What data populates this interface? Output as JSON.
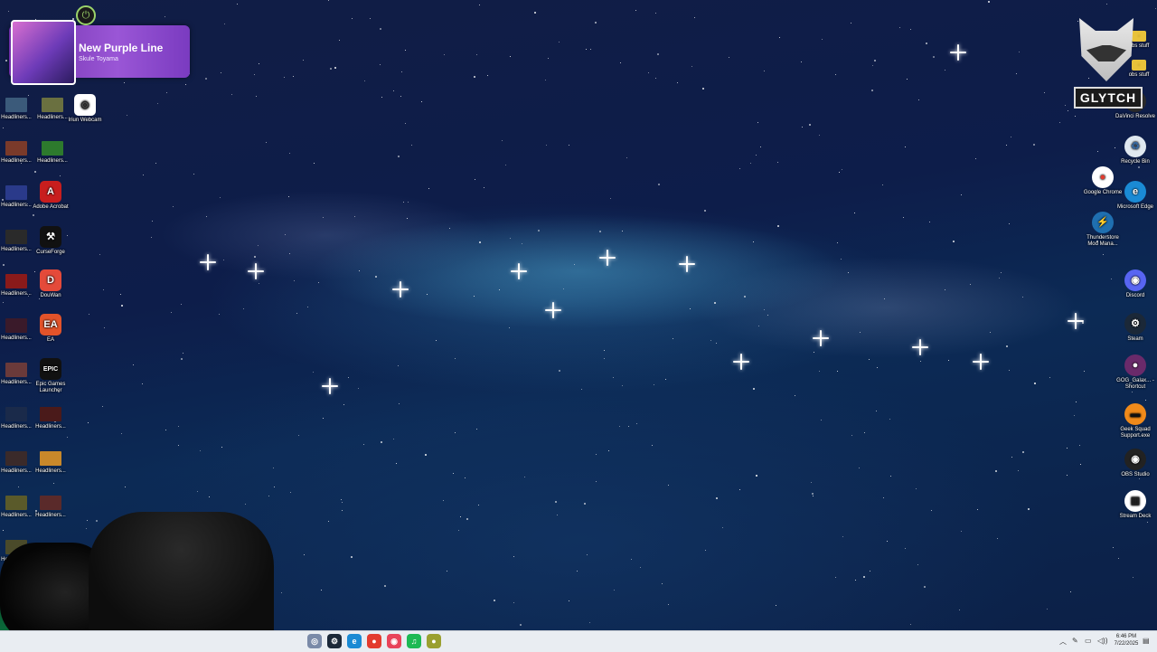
{
  "now_playing": {
    "title": "New Purple Line",
    "artist": "Skule Toyama"
  },
  "logo": {
    "text": "GLYTCH"
  },
  "left_icons": [
    {
      "label": "Headliners...",
      "thumb": "#3b5a7a"
    },
    {
      "label": "Headliners...",
      "thumb": "#6a7040"
    },
    {
      "label": "Iriun Webcam",
      "glyph": "◎",
      "bg": "#ffffff",
      "fg": "#222222"
    },
    {
      "label": "Headliners...",
      "thumb": "#7a3a2a"
    },
    {
      "label": "Headliners...",
      "thumb": "#2d7a2d"
    },
    {
      "label": "Headliners...",
      "thumb": "#2a3a8a"
    },
    {
      "label": "Adobe Acrobat",
      "glyph": "A",
      "bg": "#c81e1e",
      "fg": "#ffffff"
    },
    {
      "label": "Headliners...",
      "thumb": "#2a2a2a"
    },
    {
      "label": "CurseForge",
      "glyph": "⚒",
      "bg": "#111111",
      "fg": "#ffffff"
    },
    {
      "label": "Headliners...",
      "thumb": "#8a1a1a"
    },
    {
      "label": "DouWan",
      "glyph": "D",
      "bg": "#e44a3a",
      "fg": "#ffffff"
    },
    {
      "label": "Headliners...",
      "thumb": "#3a1a2a"
    },
    {
      "label": "EA",
      "glyph": "EA",
      "bg": "#e2532a",
      "fg": "#ffffff"
    },
    {
      "label": "Headliners...",
      "thumb": "#6a3a3a"
    },
    {
      "label": "Epic Games Launcher",
      "glyph": "EPIC",
      "bg": "#111111",
      "fg": "#ffffff"
    },
    {
      "label": "Headliners...",
      "thumb": "#1a2a4a"
    },
    {
      "label": "Headliners...",
      "thumb": "#4a1a1a"
    },
    {
      "label": "Headliners...",
      "thumb": "#3a2a2a"
    },
    {
      "label": "Headliners...",
      "thumb": "#c8882a"
    },
    {
      "label": "Headliners...",
      "thumb": "#5a5a2a"
    },
    {
      "label": "Headliners...",
      "thumb": "#5a2a2a"
    },
    {
      "label": "Headliners...",
      "thumb": "#4a4a2a"
    }
  ],
  "right_icons": [
    {
      "label": "obs stuff",
      "glyph": "▬",
      "bg": "#e8c23a",
      "fg": "#e8c23a"
    },
    {
      "label": "obs stuff",
      "glyph": "▬",
      "bg": "#e8c23a",
      "fg": "#e8c23a"
    },
    {
      "label": "DaVinci Resolve",
      "glyph": "◉",
      "bg": "#2a2a2a",
      "fg": "#ffffff"
    },
    {
      "label": "Recycle Bin",
      "glyph": "♻",
      "bg": "#dfe8f0",
      "fg": "#3a6aa0"
    },
    {
      "label": "Google Chrome",
      "glyph": "●",
      "bg": "#ffffff",
      "fg": "#e33b2e"
    },
    {
      "label": "Microsoft Edge",
      "glyph": "e",
      "bg": "#1a8ad4",
      "fg": "#ffffff"
    },
    {
      "label": "Thunderstore Mod Mana...",
      "glyph": "⚡",
      "bg": "#1f6fb0",
      "fg": "#ffffff"
    },
    {
      "label": "Discord",
      "glyph": "◉",
      "bg": "#5865f2",
      "fg": "#ffffff"
    },
    {
      "label": "Steam",
      "glyph": "⚙",
      "bg": "#1b2838",
      "fg": "#ffffff"
    },
    {
      "label": "GOG_Galax... - Shortcut",
      "glyph": "●",
      "bg": "#6a2a6a",
      "fg": "#ffffff"
    },
    {
      "label": "Geek Squad Support.exe",
      "glyph": "▬",
      "bg": "#f08a1a",
      "fg": "#111111"
    },
    {
      "label": "OBS Studio",
      "glyph": "◉",
      "bg": "#222222",
      "fg": "#ffffff"
    },
    {
      "label": "Stream Deck",
      "glyph": "▦",
      "bg": "#ffffff",
      "fg": "#222222"
    }
  ],
  "taskbar": {
    "apps": [
      {
        "name": "app",
        "glyph": "◎",
        "bg": "#7a8aa8"
      },
      {
        "name": "steam",
        "glyph": "⚙",
        "bg": "#1b2838"
      },
      {
        "name": "edge",
        "glyph": "e",
        "bg": "#1a8ad4"
      },
      {
        "name": "chrome",
        "glyph": "●",
        "bg": "#e33b2e"
      },
      {
        "name": "discord",
        "glyph": "◉",
        "bg": "#e8435a"
      },
      {
        "name": "spotify",
        "glyph": "♫",
        "bg": "#1db954"
      },
      {
        "name": "app2",
        "glyph": "●",
        "bg": "#9aa030"
      }
    ],
    "clock_time": "6:46 PM",
    "clock_date": "7/22/2025"
  }
}
